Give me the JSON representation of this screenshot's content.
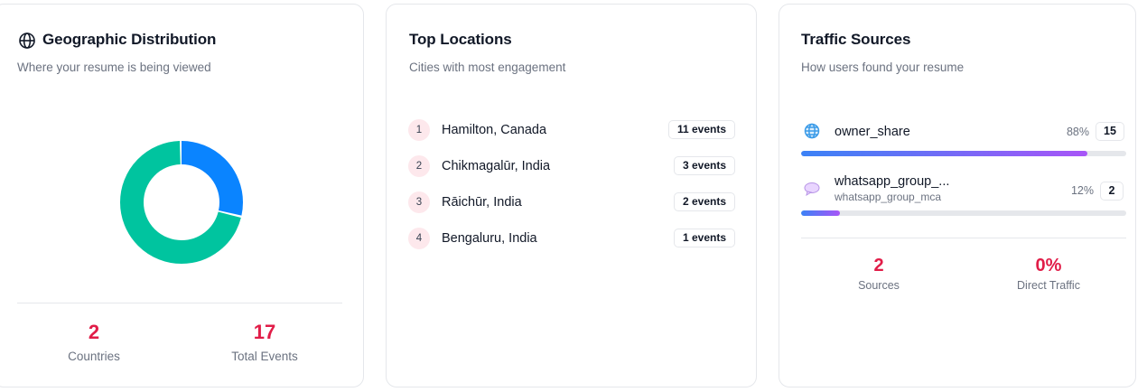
{
  "geo": {
    "title": "Geographic Distribution",
    "subtitle": "Where your resume is being viewed",
    "icon": "globe-icon",
    "donut": [
      {
        "share": 0.29,
        "color": "#0a84ff"
      },
      {
        "share": 0.71,
        "color": "#00c49f"
      }
    ],
    "stats": {
      "countries_value": "2",
      "countries_label": "Countries",
      "events_value": "17",
      "events_label": "Total Events"
    }
  },
  "locations": {
    "title": "Top Locations",
    "subtitle": "Cities with most engagement",
    "items": [
      {
        "rank": "1",
        "name": "Hamilton, Canada",
        "events": "11 events"
      },
      {
        "rank": "2",
        "name": "Chikmagalūr, India",
        "events": "3 events"
      },
      {
        "rank": "3",
        "name": "Rāichūr, India",
        "events": "2 events"
      },
      {
        "rank": "4",
        "name": "Bengaluru, India",
        "events": "1 events"
      }
    ]
  },
  "traffic": {
    "title": "Traffic Sources",
    "subtitle": "How users found your resume",
    "sources": [
      {
        "icon": "globe-icon",
        "name": "owner_share",
        "sub": "",
        "percent": "88%",
        "share": 0.88,
        "count": "15"
      },
      {
        "icon": "chat-bubble-icon",
        "name": "whatsapp_group_...",
        "sub": "whatsapp_group_mca",
        "percent": "12%",
        "share": 0.12,
        "count": "2"
      }
    ],
    "stats": {
      "sources_value": "2",
      "sources_label": "Sources",
      "direct_value": "0%",
      "direct_label": "Direct Traffic"
    }
  },
  "colors": {
    "accent_red": "#e11d48",
    "donut_blue": "#0a84ff",
    "donut_green": "#00c49f"
  }
}
